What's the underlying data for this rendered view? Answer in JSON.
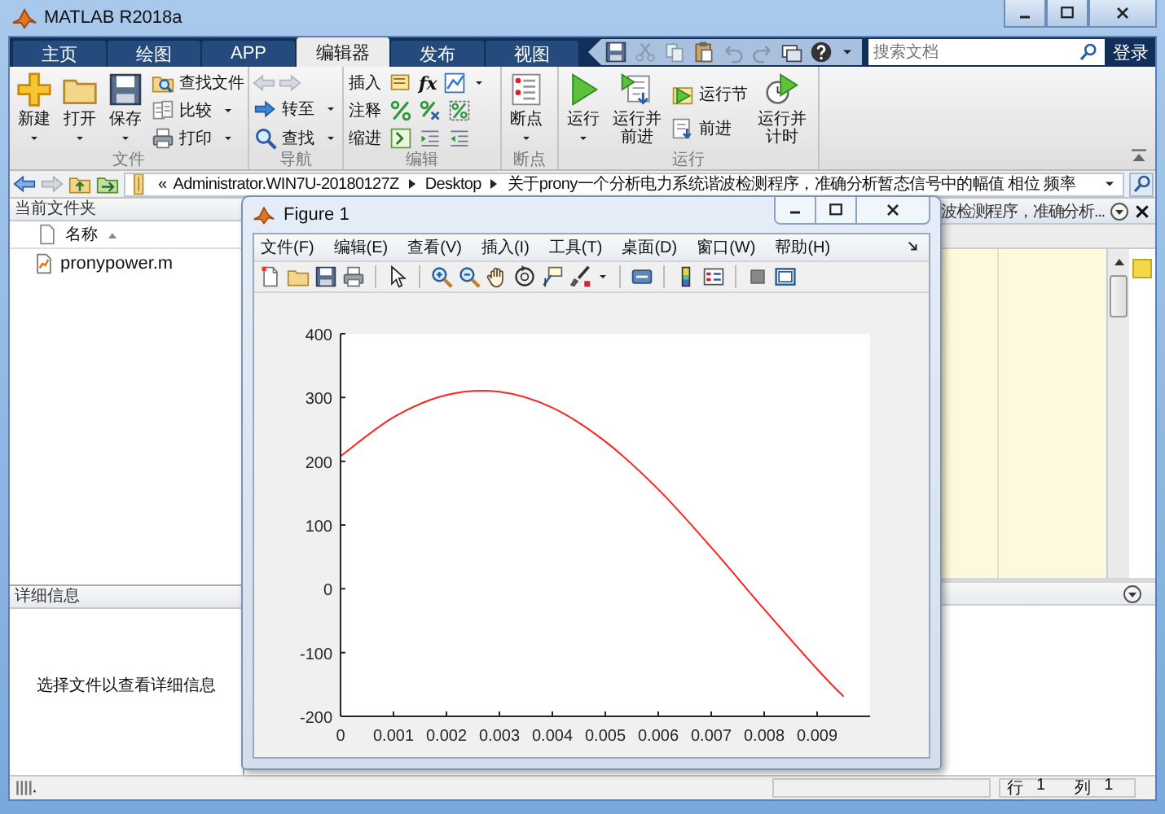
{
  "window": {
    "title": "MATLAB R2018a"
  },
  "tabs": [
    {
      "label": "主页",
      "selected": false
    },
    {
      "label": "绘图",
      "selected": false
    },
    {
      "label": "APP",
      "selected": false
    },
    {
      "label": "编辑器",
      "selected": true
    },
    {
      "label": "发布",
      "selected": false
    },
    {
      "label": "视图",
      "selected": false
    }
  ],
  "search": {
    "placeholder": "搜索文档"
  },
  "login_button": "登录",
  "ribbon": {
    "groups": [
      {
        "label": "文件",
        "items": [
          {
            "label": "新建",
            "dropdown": true
          },
          {
            "label": "打开",
            "dropdown": true
          },
          {
            "label": "保存",
            "dropdown": true
          },
          {
            "label": "查找文件",
            "dropdown": false
          },
          {
            "label": "比较",
            "dropdown": true
          },
          {
            "label": "打印",
            "dropdown": true
          }
        ]
      },
      {
        "label": "导航",
        "items": [
          {
            "label": "转至",
            "dropdown": true
          },
          {
            "label": "查找",
            "dropdown": true
          }
        ]
      },
      {
        "label": "编辑",
        "items": [
          {
            "label": "插入"
          },
          {
            "label": "注释"
          },
          {
            "label": "缩进"
          }
        ],
        "function_button": "fx"
      },
      {
        "label": "断点",
        "items": [
          {
            "label": "断点",
            "dropdown": true
          }
        ]
      },
      {
        "label": "运行",
        "items": [
          {
            "label": "运行",
            "dropdown": true
          },
          {
            "label": "运行并前进",
            "dropdown": false
          },
          {
            "label": "运行节",
            "dropdown": false
          },
          {
            "label": "前进",
            "dropdown": false
          },
          {
            "label": "运行并计时",
            "dropdown": false
          }
        ]
      }
    ]
  },
  "address_bar": {
    "overflow": "«",
    "path": [
      "Administrator.WIN7U-20180127Z",
      "Desktop",
      "关于prony一个分析电力系统谐波检测程序，准确分析暂态信号中的幅值 相位 频率"
    ]
  },
  "file_browser": {
    "title": "当前文件夹",
    "column": "名称",
    "files": [
      "pronypower.m"
    ]
  },
  "details": {
    "title": "详细信息",
    "message": "选择文件以查看详细信息"
  },
  "editor": {
    "tab_title": "波检测程序，准确分析..."
  },
  "status_bar": [
    {
      "label": "行",
      "value": "1"
    },
    {
      "label": "列",
      "value": "1"
    }
  ],
  "figure": {
    "title": "Figure 1",
    "menu": [
      "文件(F)",
      "编辑(E)",
      "查看(V)",
      "插入(I)",
      "工具(T)",
      "桌面(D)",
      "窗口(W)",
      "帮助(H)"
    ],
    "chart_data": {
      "type": "line",
      "x": [
        0,
        0.001,
        0.002,
        0.003,
        0.004,
        0.005,
        0.006,
        0.007,
        0.008,
        0.009,
        0.0095
      ],
      "series": [
        {
          "color": "#ff2020",
          "values": [
            208,
            269,
            304,
            309,
            284,
            231,
            156,
            65,
            -32,
            -126,
            -169
          ]
        }
      ],
      "xlim": [
        0,
        0.01
      ],
      "ylim": [
        -200,
        400
      ],
      "xticks": [
        0,
        0.001,
        0.002,
        0.003,
        0.004,
        0.005,
        0.006,
        0.007,
        0.008,
        0.009
      ],
      "yticks": [
        -200,
        -100,
        0,
        100,
        200,
        300,
        400
      ]
    }
  }
}
